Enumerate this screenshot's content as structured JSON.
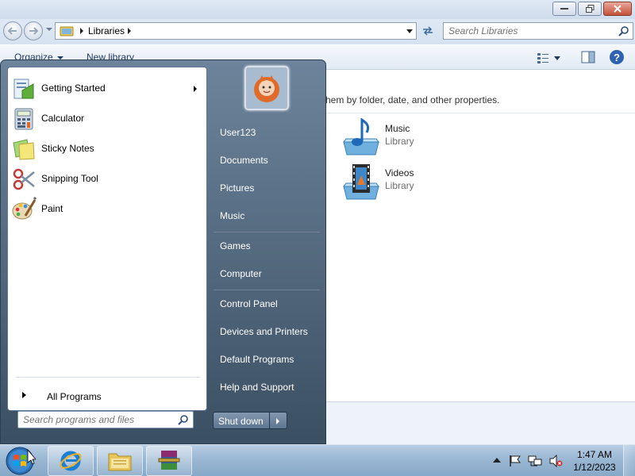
{
  "explorer": {
    "address": {
      "path": "Libraries"
    },
    "search": {
      "placeholder": "Search Libraries"
    },
    "toolbar": {
      "organize_label": "Organize",
      "new_library_label": "New library"
    },
    "content": {
      "description": "hem by folder, date, and other properties.",
      "libraries": [
        {
          "name": "Music",
          "type": "Library",
          "icon": "music-library-icon"
        },
        {
          "name": "Videos",
          "type": "Library",
          "icon": "videos-library-icon"
        }
      ]
    }
  },
  "start_menu": {
    "programs": [
      {
        "label": "Getting Started",
        "icon": "getting-started-icon",
        "has_submenu": true
      },
      {
        "label": "Calculator",
        "icon": "calculator-icon"
      },
      {
        "label": "Sticky Notes",
        "icon": "sticky-notes-icon"
      },
      {
        "label": "Snipping Tool",
        "icon": "scissors-icon"
      },
      {
        "label": "Paint",
        "icon": "paint-palette-icon"
      }
    ],
    "all_programs_label": "All Programs",
    "search_placeholder": "Search programs and files",
    "right_items": [
      {
        "label": "User123"
      },
      {
        "label": "Documents"
      },
      {
        "label": "Pictures"
      },
      {
        "label": "Music"
      },
      {
        "label": "Games"
      },
      {
        "label": "Computer"
      },
      {
        "label": "Control Panel"
      },
      {
        "label": "Devices and Printers"
      },
      {
        "label": "Default Programs"
      },
      {
        "label": "Help and Support"
      }
    ],
    "shutdown_label": "Shut down"
  },
  "taskbar": {
    "apps": [
      {
        "name": "internet-explorer-icon"
      },
      {
        "name": "windows-explorer-icon"
      },
      {
        "name": "winrar-icon"
      }
    ],
    "clock": {
      "time": "1:47 AM",
      "date": "1/12/2023"
    }
  },
  "colors": {
    "accent": "#1e3a5f",
    "start_menu_panel": "#4e6682",
    "taskbar": "#9ab7d3"
  }
}
